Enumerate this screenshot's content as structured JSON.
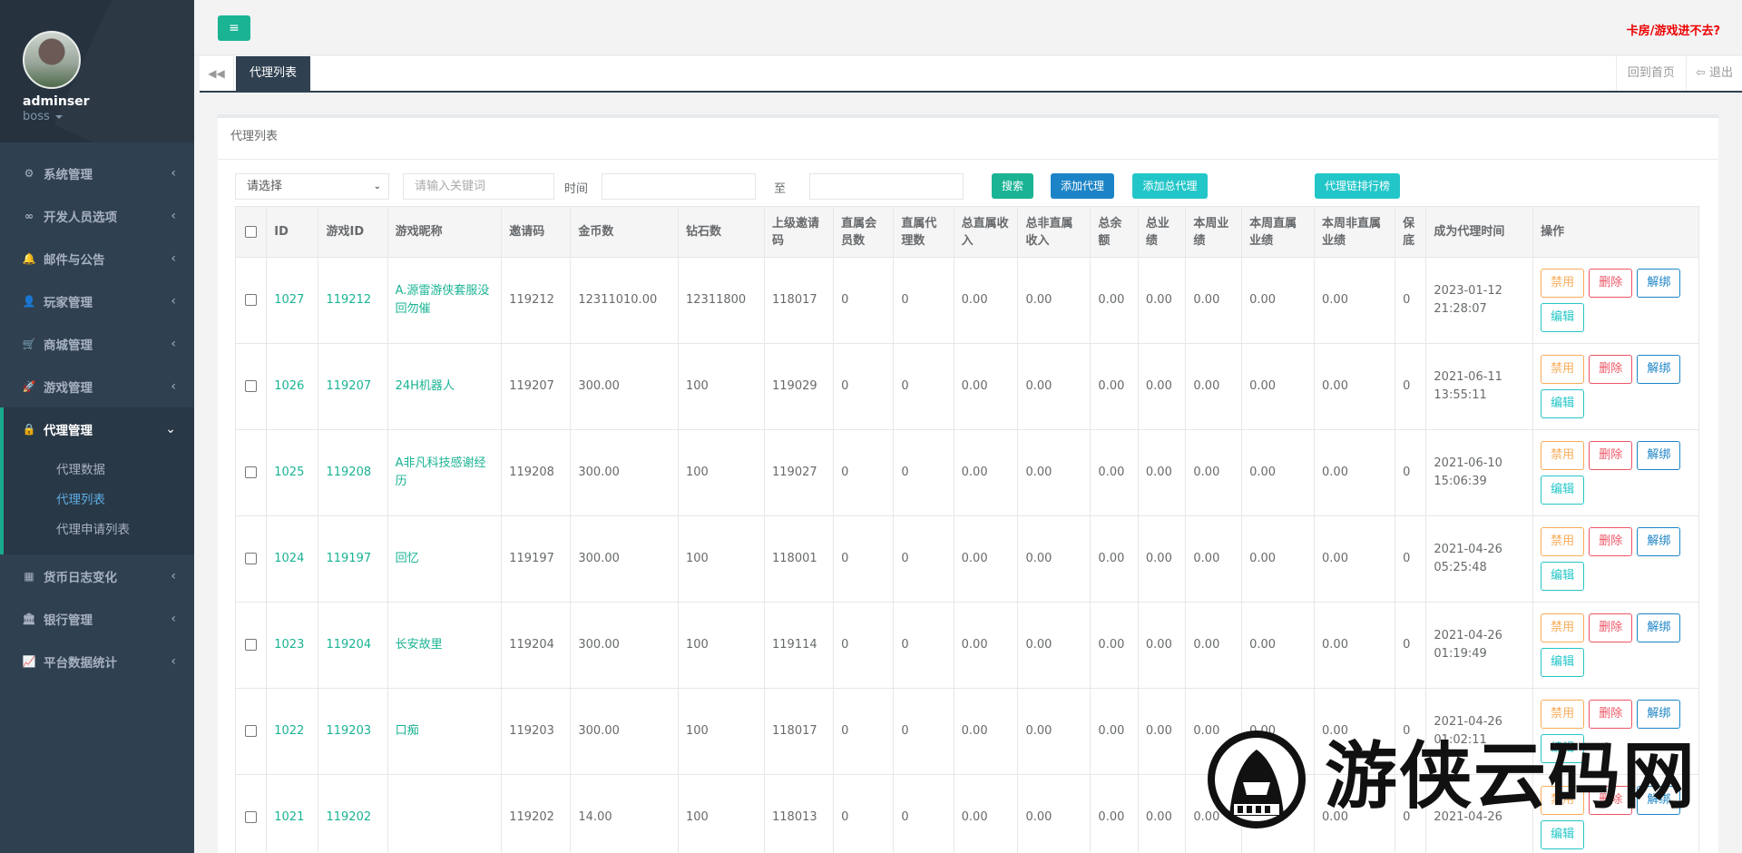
{
  "user": {
    "name": "adminser",
    "role": "boss"
  },
  "sidebar": {
    "items": [
      {
        "label": "系统管理",
        "icon": "cogs-icon",
        "glyph": "⚙"
      },
      {
        "label": "开发人员选项",
        "icon": "link-icon",
        "glyph": "∞"
      },
      {
        "label": "邮件与公告",
        "icon": "bell-icon",
        "glyph": "🔔"
      },
      {
        "label": "玩家管理",
        "icon": "user-icon",
        "glyph": "👤"
      },
      {
        "label": "商城管理",
        "icon": "cart-icon",
        "glyph": "🛒"
      },
      {
        "label": "游戏管理",
        "icon": "rocket-icon",
        "glyph": "🚀"
      },
      {
        "label": "代理管理",
        "icon": "lock-icon",
        "glyph": "🔒"
      },
      {
        "label": "货币日志变化",
        "icon": "calendar-icon",
        "glyph": "▦"
      },
      {
        "label": "银行管理",
        "icon": "bank-icon",
        "glyph": "🏛"
      },
      {
        "label": "平台数据统计",
        "icon": "chart-icon",
        "glyph": "📈"
      }
    ],
    "sub_items": [
      "代理数据",
      "代理列表",
      "代理申请列表"
    ]
  },
  "topbar": {
    "menu_icon": "≡",
    "hint": "卡房/游戏进不去?"
  },
  "tabs": {
    "back_icon": "◀◀",
    "active": "代理列表",
    "home": "回到首页",
    "exit": "退出",
    "exit_icon": "⇦"
  },
  "panel": {
    "title": "代理列表"
  },
  "filters": {
    "select_value": "请选择",
    "keyword_placeholder": "请输入关键词",
    "time_label": "时间",
    "to_label": "至",
    "search": "搜索",
    "add_agent": "添加代理",
    "add_top_agent": "添加总代理",
    "ranking": "代理链排行榜"
  },
  "table": {
    "headers": [
      "ID",
      "游戏ID",
      "游戏昵称",
      "邀请码",
      "金币数",
      "钻石数",
      "上级邀请码",
      "直属会员数",
      "直属代理数",
      "总直属收入",
      "总非直属收入",
      "总余额",
      "总业绩",
      "本周业绩",
      "本周直属业绩",
      "本周非直属业绩",
      "保底",
      "成为代理时间",
      "操作"
    ],
    "ops": {
      "disable": "禁用",
      "delete": "删除",
      "unbind": "解绑",
      "edit": "编辑"
    },
    "rows": [
      {
        "id": "1027",
        "game_id": "119212",
        "nickname": "A.源雷游侠套服没回勿催",
        "invite": "119212",
        "gold": "12311010.00",
        "diamond": "12311800",
        "parent": "118017",
        "members": "0",
        "agents": "0",
        "direct_income": "0.00",
        "indirect_income": "0.00",
        "balance": "0.00",
        "perf": "0.00",
        "week_perf": "0.00",
        "week_direct": "0.00",
        "week_indirect": "0.00",
        "floor": "0",
        "time": "2023-01-12 21:28:07"
      },
      {
        "id": "1026",
        "game_id": "119207",
        "nickname": "24H机器人",
        "invite": "119207",
        "gold": "300.00",
        "diamond": "100",
        "parent": "119029",
        "members": "0",
        "agents": "0",
        "direct_income": "0.00",
        "indirect_income": "0.00",
        "balance": "0.00",
        "perf": "0.00",
        "week_perf": "0.00",
        "week_direct": "0.00",
        "week_indirect": "0.00",
        "floor": "0",
        "time": "2021-06-11 13:55:11"
      },
      {
        "id": "1025",
        "game_id": "119208",
        "nickname": "A非凡科技感谢经历",
        "invite": "119208",
        "gold": "300.00",
        "diamond": "100",
        "parent": "119027",
        "members": "0",
        "agents": "0",
        "direct_income": "0.00",
        "indirect_income": "0.00",
        "balance": "0.00",
        "perf": "0.00",
        "week_perf": "0.00",
        "week_direct": "0.00",
        "week_indirect": "0.00",
        "floor": "0",
        "time": "2021-06-10 15:06:39"
      },
      {
        "id": "1024",
        "game_id": "119197",
        "nickname": "回忆",
        "invite": "119197",
        "gold": "300.00",
        "diamond": "100",
        "parent": "118001",
        "members": "0",
        "agents": "0",
        "direct_income": "0.00",
        "indirect_income": "0.00",
        "balance": "0.00",
        "perf": "0.00",
        "week_perf": "0.00",
        "week_direct": "0.00",
        "week_indirect": "0.00",
        "floor": "0",
        "time": "2021-04-26 05:25:48"
      },
      {
        "id": "1023",
        "game_id": "119204",
        "nickname": "长安故里",
        "invite": "119204",
        "gold": "300.00",
        "diamond": "100",
        "parent": "119114",
        "members": "0",
        "agents": "0",
        "direct_income": "0.00",
        "indirect_income": "0.00",
        "balance": "0.00",
        "perf": "0.00",
        "week_perf": "0.00",
        "week_direct": "0.00",
        "week_indirect": "0.00",
        "floor": "0",
        "time": "2021-04-26 01:19:49"
      },
      {
        "id": "1022",
        "game_id": "119203",
        "nickname": "口痴",
        "invite": "119203",
        "gold": "300.00",
        "diamond": "100",
        "parent": "118017",
        "members": "0",
        "agents": "0",
        "direct_income": "0.00",
        "indirect_income": "0.00",
        "balance": "0.00",
        "perf": "0.00",
        "week_perf": "0.00",
        "week_direct": "0.00",
        "week_indirect": "0.00",
        "floor": "0",
        "time": "2021-04-26 01:02:11"
      },
      {
        "id": "1021",
        "game_id": "119202",
        "nickname": "",
        "invite": "119202",
        "gold": "14.00",
        "diamond": "100",
        "parent": "118013",
        "members": "0",
        "agents": "0",
        "direct_income": "0.00",
        "indirect_income": "0.00",
        "balance": "0.00",
        "perf": "0.00",
        "week_perf": "0.00",
        "week_direct": "0.00",
        "week_indirect": "0.00",
        "floor": "0",
        "time": "2021-04-26"
      }
    ]
  },
  "watermark": {
    "text": "游侠云码网"
  }
}
